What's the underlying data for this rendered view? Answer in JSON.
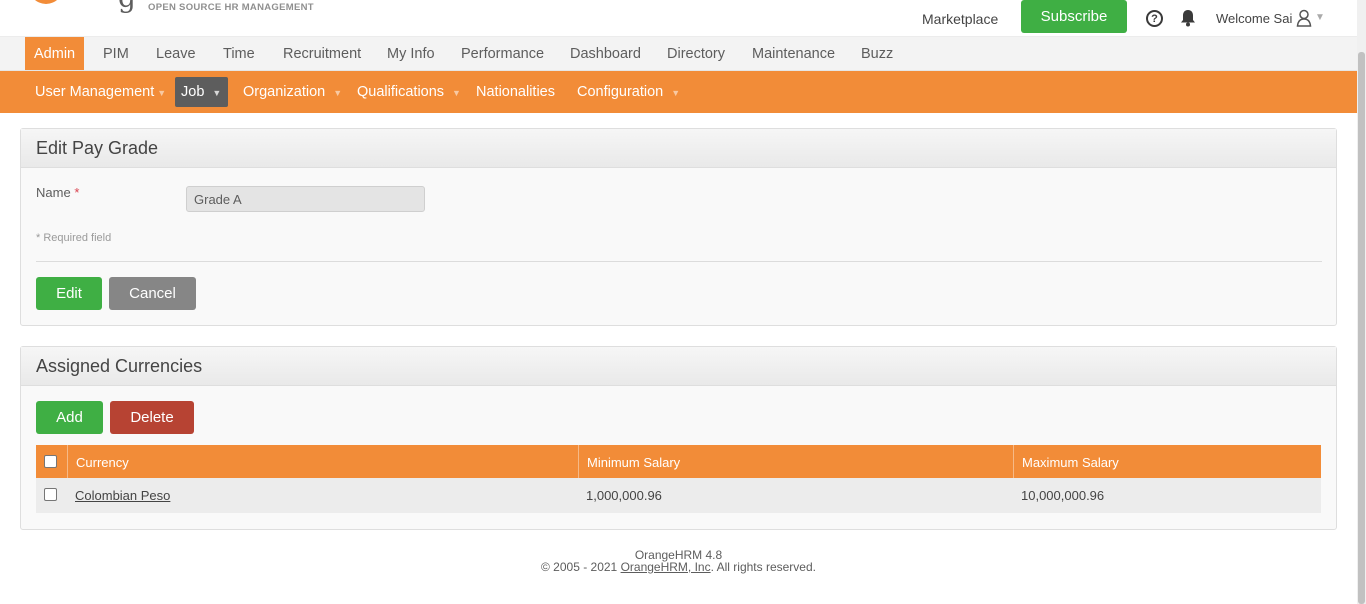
{
  "header": {
    "logo_tagline": "OPEN SOURCE HR MANAGEMENT",
    "marketplace": "Marketplace",
    "subscribe": "Subscribe",
    "welcome": "Welcome Sai"
  },
  "main_menu": {
    "items": [
      "Admin",
      "PIM",
      "Leave",
      "Time",
      "Recruitment",
      "My Info",
      "Performance",
      "Dashboard",
      "Directory",
      "Maintenance",
      "Buzz"
    ],
    "active": "Admin"
  },
  "sub_menu": {
    "items": [
      "User Management",
      "Job",
      "Organization",
      "Qualifications",
      "Nationalities",
      "Configuration"
    ],
    "active": "Job"
  },
  "edit_pay_grade": {
    "title": "Edit Pay Grade",
    "name_label": "Name",
    "required_mark": "*",
    "name_value": "Grade A",
    "required_note": "* Required field",
    "edit_button": "Edit",
    "cancel_button": "Cancel"
  },
  "assigned_currencies": {
    "title": "Assigned Currencies",
    "add_button": "Add",
    "delete_button": "Delete",
    "columns": [
      "Currency",
      "Minimum Salary",
      "Maximum Salary"
    ],
    "rows": [
      {
        "currency": "Colombian Peso",
        "min_salary": "1,000,000.96",
        "max_salary": "10,000,000.96"
      }
    ]
  },
  "footer": {
    "version": "OrangeHRM 4.8",
    "copyright_prefix": "© 2005 - 2021 ",
    "company_link": "OrangeHRM, Inc",
    "copyright_suffix": ". All rights reserved."
  },
  "colors": {
    "brand_orange": "#f28c38",
    "button_green": "#3faf44",
    "button_grey": "#868686",
    "button_red": "#b74333"
  }
}
